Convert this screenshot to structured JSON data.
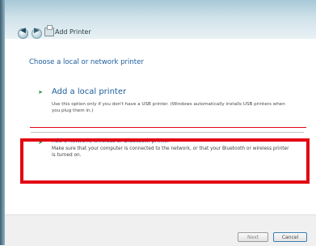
{
  "window": {
    "title": "Add Printer",
    "nav": {
      "back_icon": "back-arrow-icon",
      "forward_icon": "forward-arrow-icon"
    }
  },
  "main": {
    "heading": "Choose a local or network printer",
    "options": [
      {
        "label": "Add a local printer",
        "description": "Use this option only if you don't have a USB printer. (Windows automatically installs USB printers when you plug them in.)"
      },
      {
        "label": "Add a network, wireless or Bluetooth printer",
        "description": "Make sure that your computer is connected to the network, or that your Bluetooth or wireless printer is turned on."
      }
    ]
  },
  "footer": {
    "next_label": "Next",
    "cancel_label": "Cancel"
  },
  "colors": {
    "accent": "#1e5d9c",
    "highlight": "#e30613"
  }
}
